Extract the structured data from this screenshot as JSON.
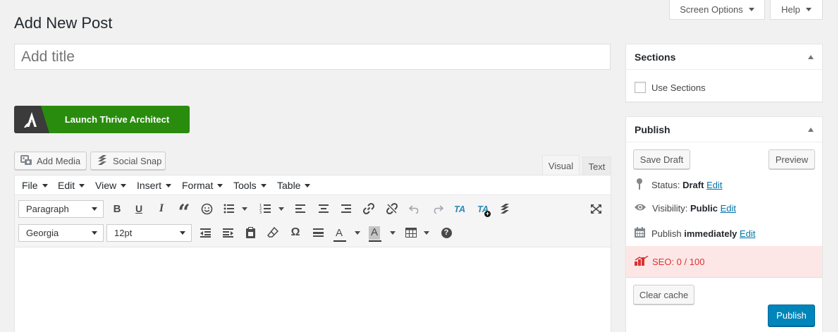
{
  "screen": {
    "screen_options": "Screen Options",
    "help": "Help"
  },
  "page": {
    "title": "Add New Post",
    "title_placeholder": "Add title"
  },
  "thrive": {
    "launch_label": "Launch Thrive Architect",
    "brand_color": "#2a8c0e"
  },
  "media": {
    "add_media": "Add Media",
    "social_snap": "Social Snap"
  },
  "editor_tabs": {
    "visual": "Visual",
    "text": "Text"
  },
  "menubar": [
    "File",
    "Edit",
    "View",
    "Insert",
    "Format",
    "Tools",
    "Table"
  ],
  "toolbar": {
    "block_format": "Paragraph",
    "font_family": "Georgia",
    "font_size": "12pt",
    "row1_icons": [
      "bold-icon",
      "underline-icon",
      "italic-icon",
      "blockquote-icon",
      "emoji-icon",
      "bullet-list-icon",
      "numbered-list-icon",
      "align-left-icon",
      "align-center-icon",
      "align-right-icon",
      "link-icon",
      "unlink-icon",
      "undo-icon",
      "redo-icon",
      "thrive-ta-icon",
      "thrive-ta-plus-icon",
      "social-snap-icon",
      "fullscreen-icon"
    ],
    "bold_glyph": "B",
    "underline_glyph": "U",
    "italic_glyph": "I",
    "quote_glyph": "“",
    "omega_glyph": "Ω",
    "text_color_glyph": "A",
    "ta_label": "TA",
    "help_glyph": "?"
  },
  "sections_box": {
    "title": "Sections",
    "use_sections": "Use Sections",
    "checked": false
  },
  "publish_box": {
    "title": "Publish",
    "save_draft": "Save Draft",
    "preview": "Preview",
    "status_label": "Status:",
    "status_value": "Draft",
    "visibility_label": "Visibility:",
    "visibility_value": "Public",
    "publish_label": "Publish",
    "publish_value": "immediately",
    "edit": "Edit",
    "seo": "SEO: 0 / 100",
    "clear_cache": "Clear cache",
    "publish_button": "Publish"
  },
  "colors": {
    "primary": "#0085ba",
    "link": "#0073aa",
    "seo_bg": "#fce7e6",
    "seo_text": "#dc3232"
  }
}
